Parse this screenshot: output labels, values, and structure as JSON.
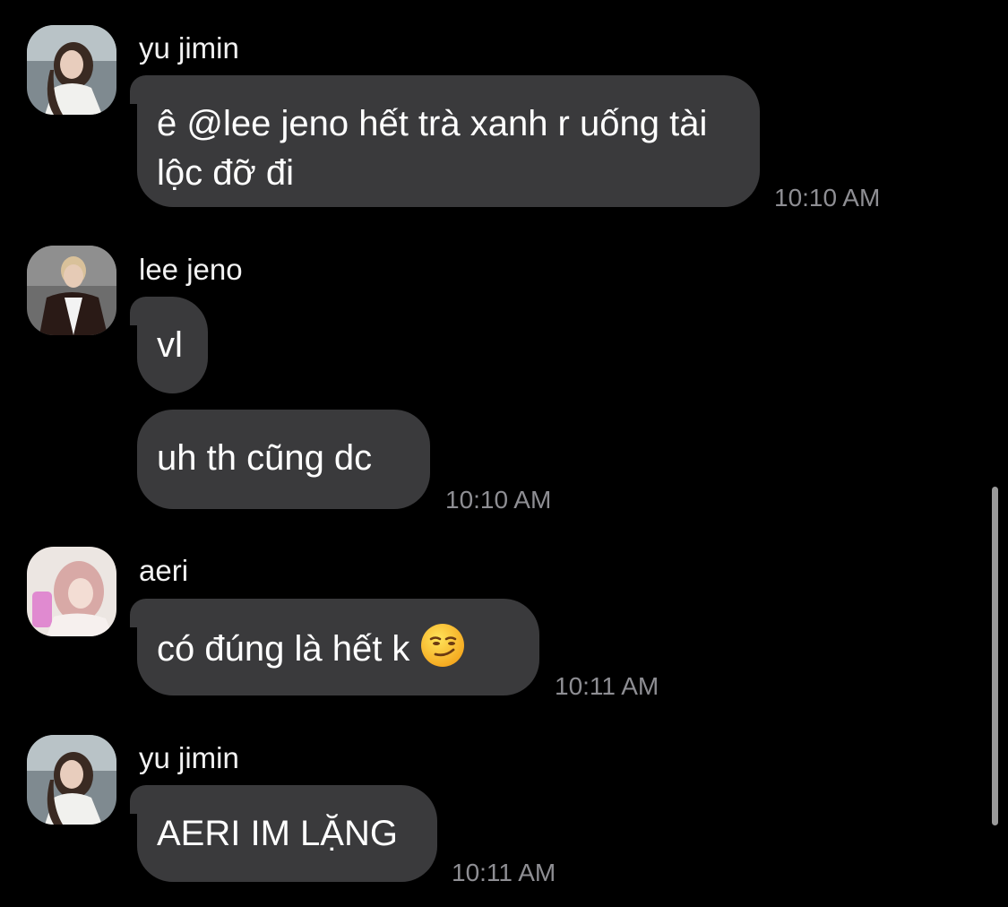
{
  "messages": [
    {
      "sender": "yu jimin",
      "text": "ê @lee jeno hết trà xanh r uống tài lộc đỡ đi",
      "time": "10:10 AM",
      "avatar": "avatar-yu-jimin"
    },
    {
      "sender": "lee jeno",
      "text": "vl",
      "time": "",
      "avatar": "avatar-lee-jeno"
    },
    {
      "sender": "",
      "text": "uh th cũng dc",
      "time": "10:10 AM",
      "avatar": ""
    },
    {
      "sender": "aeri",
      "text": "có đúng là hết k",
      "emoji": "smirking-face-emoji",
      "time": "10:11 AM",
      "avatar": "avatar-aeri"
    },
    {
      "sender": "yu jimin",
      "text": "AERI IM LẶNG",
      "time": "10:11 AM",
      "avatar": "avatar-yu-jimin"
    }
  ],
  "colors": {
    "background": "#000000",
    "bubble": "#3a3a3c",
    "timestamp": "#8e8e93"
  }
}
